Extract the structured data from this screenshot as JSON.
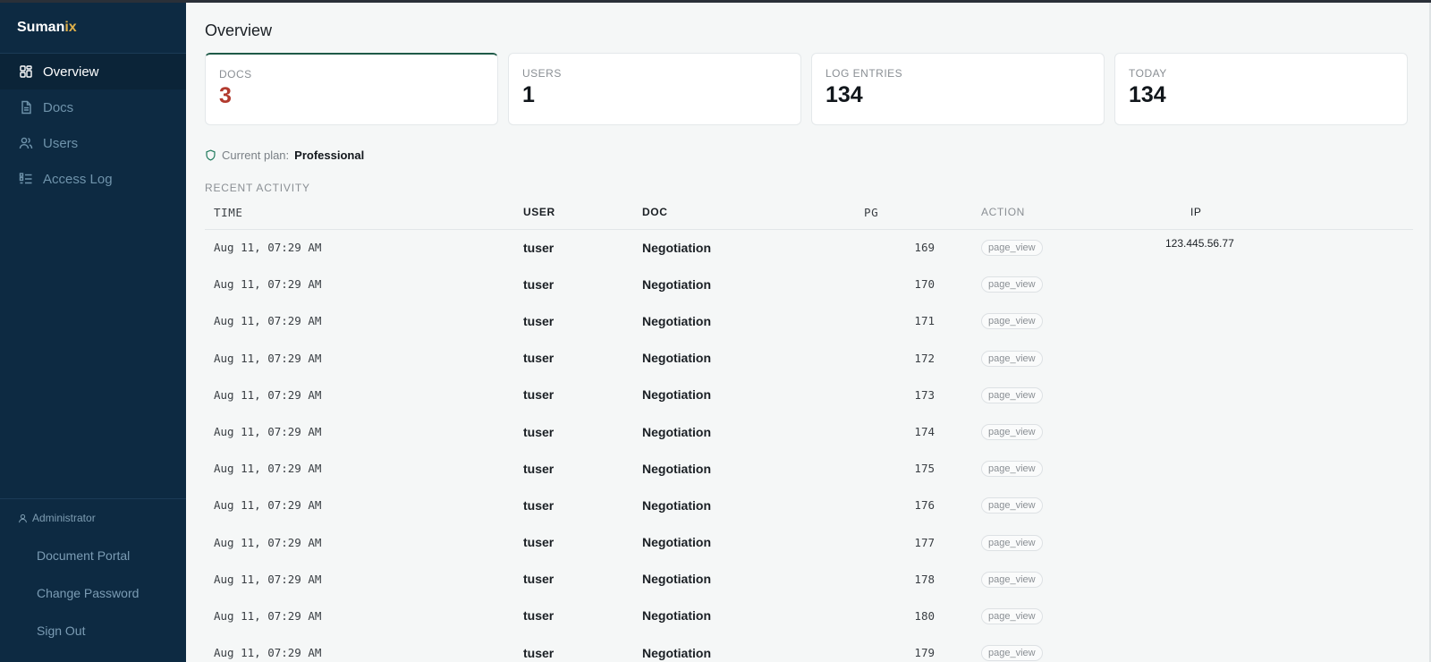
{
  "brand": {
    "name_main": "Suman",
    "name_accent": "ix"
  },
  "sidebar": {
    "items": [
      {
        "label": "Overview",
        "icon": "dashboard-icon",
        "active": true
      },
      {
        "label": "Docs",
        "icon": "document-icon",
        "active": false
      },
      {
        "label": "Users",
        "icon": "users-icon",
        "active": false
      },
      {
        "label": "Access Log",
        "icon": "list-icon",
        "active": false
      }
    ],
    "role": "Administrator",
    "links": [
      "Document Portal",
      "Change Password",
      "Sign Out"
    ]
  },
  "main": {
    "title": "Overview",
    "stats": [
      {
        "label": "DOCS",
        "value": "3"
      },
      {
        "label": "USERS",
        "value": "1"
      },
      {
        "label": "LOG ENTRIES",
        "value": "134"
      },
      {
        "label": "TODAY",
        "value": "134"
      }
    ],
    "plan": {
      "label": "Current plan:",
      "name": "Professional"
    },
    "activity": {
      "title": "RECENT ACTIVITY",
      "columns": [
        "TIME",
        "USER",
        "DOC",
        "PG",
        "ACTION",
        "IP"
      ],
      "rows": [
        {
          "time": "Aug 11, 07:29 AM",
          "user": "tuser",
          "doc": "Negotiation",
          "pg": "169",
          "action": "page_view",
          "ip": "123.445.56.77"
        },
        {
          "time": "Aug 11, 07:29 AM",
          "user": "tuser",
          "doc": "Negotiation",
          "pg": "170",
          "action": "page_view",
          "ip": ""
        },
        {
          "time": "Aug 11, 07:29 AM",
          "user": "tuser",
          "doc": "Negotiation",
          "pg": "171",
          "action": "page_view",
          "ip": ""
        },
        {
          "time": "Aug 11, 07:29 AM",
          "user": "tuser",
          "doc": "Negotiation",
          "pg": "172",
          "action": "page_view",
          "ip": ""
        },
        {
          "time": "Aug 11, 07:29 AM",
          "user": "tuser",
          "doc": "Negotiation",
          "pg": "173",
          "action": "page_view",
          "ip": ""
        },
        {
          "time": "Aug 11, 07:29 AM",
          "user": "tuser",
          "doc": "Negotiation",
          "pg": "174",
          "action": "page_view",
          "ip": ""
        },
        {
          "time": "Aug 11, 07:29 AM",
          "user": "tuser",
          "doc": "Negotiation",
          "pg": "175",
          "action": "page_view",
          "ip": ""
        },
        {
          "time": "Aug 11, 07:29 AM",
          "user": "tuser",
          "doc": "Negotiation",
          "pg": "176",
          "action": "page_view",
          "ip": ""
        },
        {
          "time": "Aug 11, 07:29 AM",
          "user": "tuser",
          "doc": "Negotiation",
          "pg": "177",
          "action": "page_view",
          "ip": ""
        },
        {
          "time": "Aug 11, 07:29 AM",
          "user": "tuser",
          "doc": "Negotiation",
          "pg": "178",
          "action": "page_view",
          "ip": ""
        },
        {
          "time": "Aug 11, 07:29 AM",
          "user": "tuser",
          "doc": "Negotiation",
          "pg": "180",
          "action": "page_view",
          "ip": ""
        },
        {
          "time": "Aug 11, 07:29 AM",
          "user": "tuser",
          "doc": "Negotiation",
          "pg": "179",
          "action": "page_view",
          "ip": ""
        }
      ]
    }
  },
  "colors": {
    "sidebar_bg": "#0d2a42",
    "brand_accent": "#e0b14a",
    "docs_value": "#b23a2e",
    "active_card_border": "#1f5a48"
  }
}
